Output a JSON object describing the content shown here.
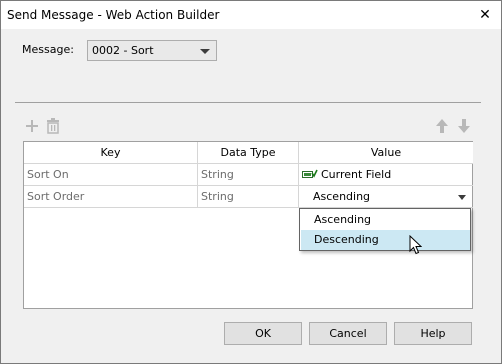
{
  "window": {
    "title": "Send Message - Web Action Builder",
    "close_glyph": "✕"
  },
  "message": {
    "label": "Message:",
    "selected": "0002 - Sort"
  },
  "toolbar": {
    "add_icon": "plus-icon",
    "delete_icon": "trash-icon",
    "up_icon": "arrow-up-icon",
    "down_icon": "arrow-down-icon"
  },
  "table": {
    "headers": [
      "Key",
      "Data Type",
      "Value"
    ],
    "rows": [
      {
        "key": "Sort On",
        "data_type": "String",
        "value": "Current Field"
      },
      {
        "key": "Sort Order",
        "data_type": "String",
        "value": "Ascending"
      }
    ]
  },
  "dropdown": {
    "options": [
      "Ascending",
      "Descending"
    ],
    "highlighted": "Descending"
  },
  "buttons": {
    "ok": "OK",
    "cancel": "Cancel",
    "help": "Help"
  },
  "colors": {
    "highlight": "#cce8f3",
    "icon_disabled": "#b8b8b8"
  }
}
